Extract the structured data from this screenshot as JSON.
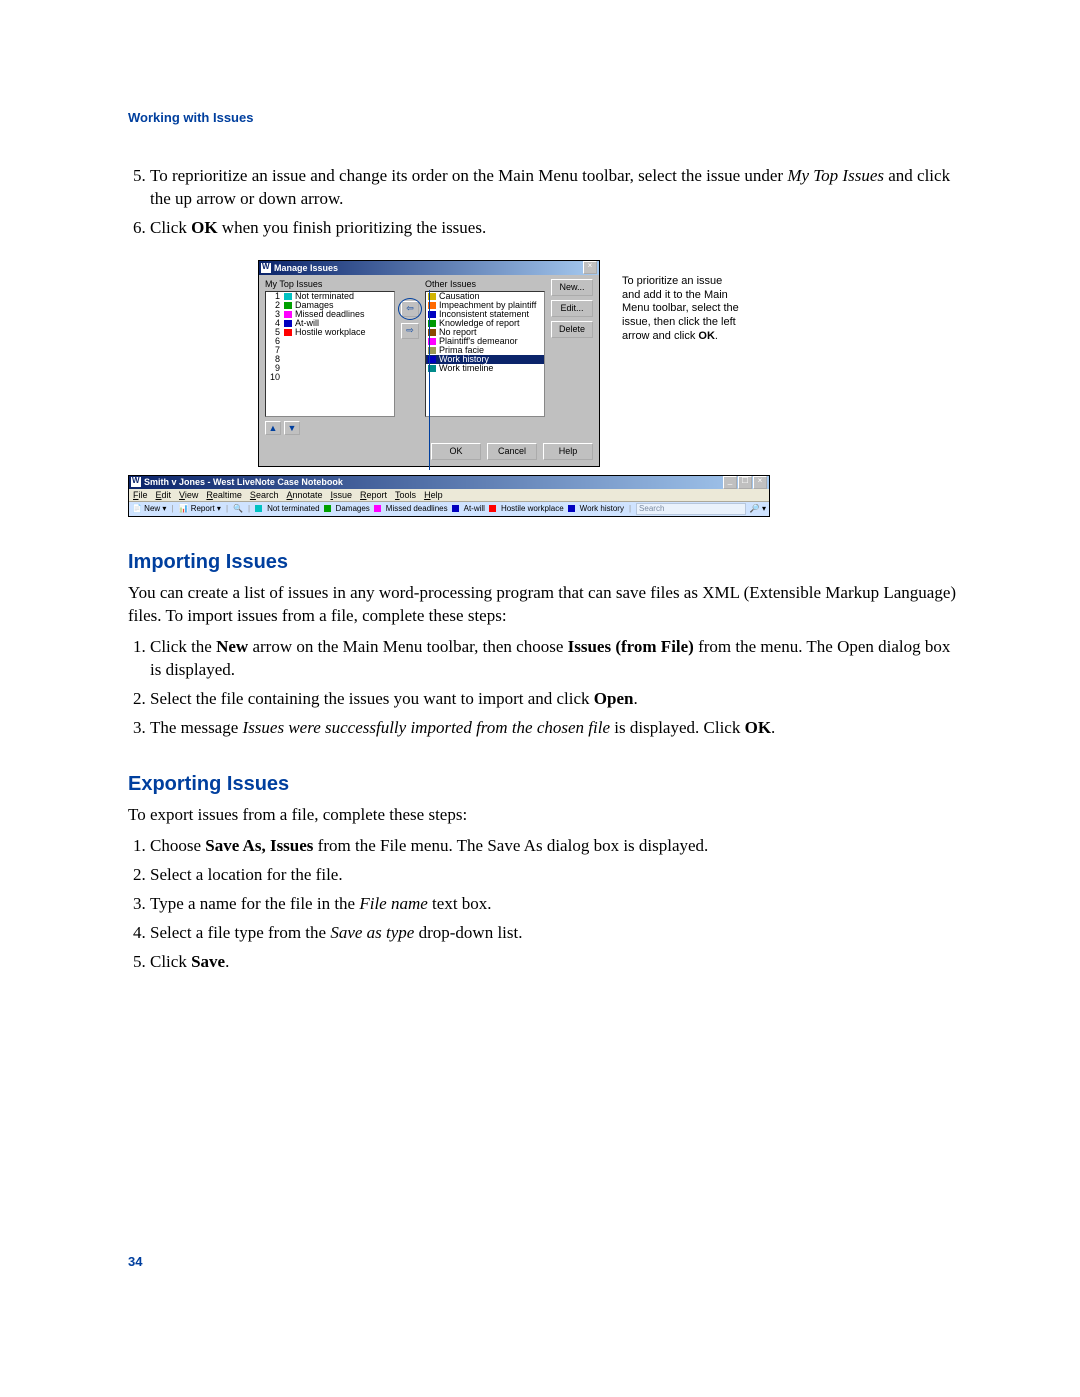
{
  "header": {
    "title": "Working with Issues"
  },
  "steps_a": {
    "start": 5,
    "items": [
      {
        "pre": "To reprioritize an issue and change its order on the Main Menu toolbar, select the issue under ",
        "em": "My Top Issues",
        "post": " and click the up arrow or down arrow."
      },
      {
        "pre": "Click ",
        "b": "OK",
        "post": " when you finish prioritizing the issues."
      }
    ]
  },
  "caption": {
    "text": "To prioritize an issue and add it to the Main Menu toolbar, select the issue, then click the left arrow and click ",
    "b": "OK",
    "post": "."
  },
  "dialog": {
    "title": "Manage Issues",
    "mytop_label": "My Top Issues",
    "other_label": "Other Issues",
    "mytop": [
      {
        "n": "1",
        "c": "#00c2c2",
        "t": "Not terminated"
      },
      {
        "n": "2",
        "c": "#00a000",
        "t": "Damages"
      },
      {
        "n": "3",
        "c": "#ff00ff",
        "t": "Missed deadlines"
      },
      {
        "n": "4",
        "c": "#0000c0",
        "t": "At-will"
      },
      {
        "n": "5",
        "c": "#ff0000",
        "t": "Hostile workplace"
      },
      {
        "n": "6",
        "c": "",
        "t": ""
      },
      {
        "n": "7",
        "c": "",
        "t": ""
      },
      {
        "n": "8",
        "c": "",
        "t": ""
      },
      {
        "n": "9",
        "c": "",
        "t": ""
      },
      {
        "n": "10",
        "c": "",
        "t": ""
      }
    ],
    "other": [
      {
        "c": "#d2b400",
        "t": "Causation",
        "sel": false
      },
      {
        "c": "#ff6a00",
        "t": "Impeachment by plaintiff",
        "sel": false
      },
      {
        "c": "#0000c0",
        "t": "Inconsistent statement",
        "sel": false
      },
      {
        "c": "#009a00",
        "t": "Knowledge of report",
        "sel": false
      },
      {
        "c": "#8a4a00",
        "t": "No report",
        "sel": false
      },
      {
        "c": "#ff00ff",
        "t": "Plaintiff's demeanor",
        "sel": false
      },
      {
        "c": "#9a9a56",
        "t": "Prima facie",
        "sel": false
      },
      {
        "c": "#0000c0",
        "t": "Work history",
        "sel": true
      },
      {
        "c": "#008a8a",
        "t": "Work timeline",
        "sel": false
      }
    ],
    "btn_new": "New...",
    "btn_edit": "Edit...",
    "btn_delete": "Delete",
    "btn_ok": "OK",
    "btn_cancel": "Cancel",
    "btn_help": "Help"
  },
  "mainwin": {
    "title": "Smith v Jones - West LiveNote Case Notebook",
    "menu": [
      "File",
      "Edit",
      "View",
      "Realtime",
      "Search",
      "Annotate",
      "Issue",
      "Report",
      "Tools",
      "Help"
    ],
    "toolbar": {
      "new": "New",
      "report": "Report",
      "issues": [
        {
          "c": "#00c2c2",
          "t": "Not terminated"
        },
        {
          "c": "#00a000",
          "t": "Damages"
        },
        {
          "c": "#ff00ff",
          "t": "Missed deadlines"
        },
        {
          "c": "#0000c0",
          "t": "At-will"
        },
        {
          "c": "#ff0000",
          "t": "Hostile workplace"
        },
        {
          "c": "#0000c0",
          "t": "Work history"
        }
      ],
      "search_ph": "Search"
    }
  },
  "importing": {
    "heading": "Importing Issues",
    "intro": "You can create a list of issues in any word-processing program that can save files as XML (Extensible Markup Language) files. To import issues from a file, complete these steps:",
    "steps": [
      {
        "parts": [
          "Click the ",
          {
            "b": "New"
          },
          " arrow on the Main Menu toolbar, then choose ",
          {
            "b": "Issues (from File)"
          },
          " from the menu. The Open dialog box is displayed."
        ]
      },
      {
        "parts": [
          "Select the file containing the issues you want to import and click ",
          {
            "b": "Open"
          },
          "."
        ]
      },
      {
        "parts": [
          "The message ",
          {
            "i": "Issues were successfully imported from the chosen file"
          },
          " is displayed. Click ",
          {
            "b": "OK"
          },
          "."
        ]
      }
    ]
  },
  "exporting": {
    "heading": "Exporting Issues",
    "intro": "To export issues from a file, complete these steps:",
    "steps": [
      {
        "parts": [
          "Choose ",
          {
            "b": "Save As, Issues"
          },
          " from the File menu. The Save As dialog box is displayed."
        ]
      },
      {
        "parts": [
          "Select a location for the file."
        ]
      },
      {
        "parts": [
          "Type a name for the file in the ",
          {
            "i": "File name"
          },
          " text box."
        ]
      },
      {
        "parts": [
          "Select a file type from the ",
          {
            "i": "Save as type"
          },
          " drop-down list."
        ]
      },
      {
        "parts": [
          "Click ",
          {
            "b": "Save"
          },
          "."
        ]
      }
    ]
  },
  "page_num": "34"
}
